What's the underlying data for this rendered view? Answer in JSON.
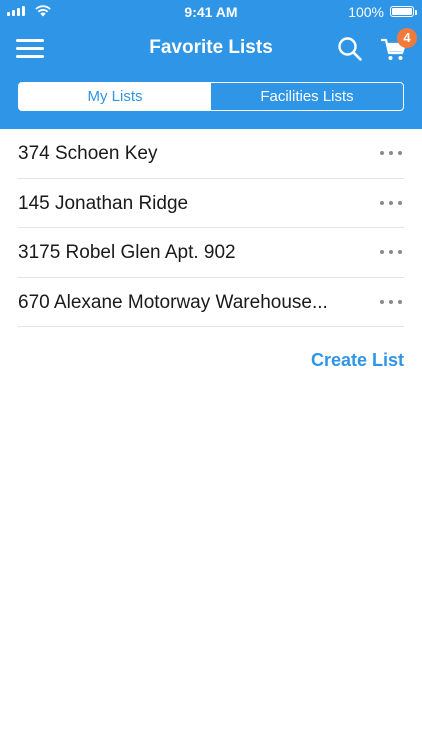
{
  "status_bar": {
    "time": "9:41 AM",
    "battery_percent": "100%"
  },
  "header": {
    "title": "Favorite Lists",
    "cart_count": "4",
    "icons": [
      "hamburger-menu-icon",
      "search-icon",
      "shopping-cart-icon"
    ],
    "color": "#2f95e6",
    "badge_color": "#f07a3c"
  },
  "tabs": [
    {
      "label": "My Lists",
      "selected": true
    },
    {
      "label": "Facilities Lists",
      "selected": false
    }
  ],
  "lists": [
    {
      "name": "374 Schoen Key"
    },
    {
      "name": "145 Jonathan Ridge"
    },
    {
      "name": "3175 Robel Glen Apt. 902"
    },
    {
      "name": "670 Alexane Motorway Warehouse..."
    }
  ],
  "actions": {
    "create_list": "Create List"
  }
}
